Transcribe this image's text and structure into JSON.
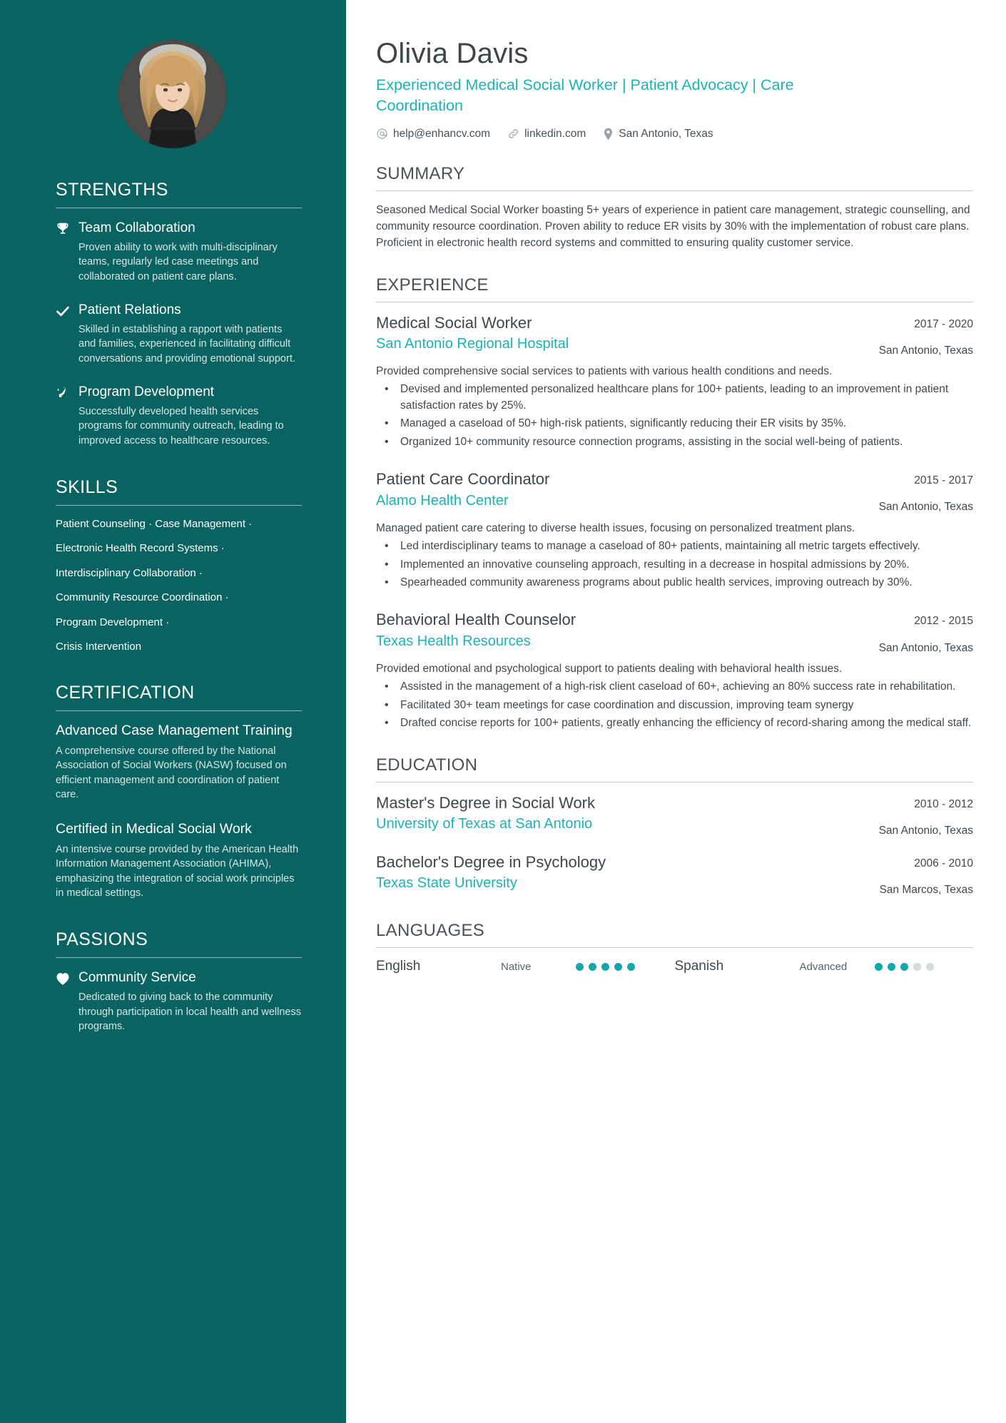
{
  "theme": {
    "sidebar_bg": "#0a6360",
    "accent": "#1ab3b8",
    "text": "#42484d"
  },
  "header": {
    "name": "Olivia Davis",
    "headline": "Experienced Medical Social Worker | Patient Advocacy | Care Coordination",
    "contacts": [
      {
        "icon": "at-icon",
        "text": "help@enhancv.com"
      },
      {
        "icon": "link-icon",
        "text": "linkedin.com"
      },
      {
        "icon": "location-pin-icon",
        "text": "San Antonio, Texas"
      }
    ]
  },
  "sidebar": {
    "strengths": {
      "heading": "STRENGTHS",
      "items": [
        {
          "icon": "trophy-icon",
          "title": "Team Collaboration",
          "description": "Proven ability to work with multi-disciplinary teams, regularly led case meetings and collaborated on patient care plans."
        },
        {
          "icon": "check-icon",
          "title": "Patient Relations",
          "description": "Skilled in establishing a rapport with patients and families, experienced in facilitating difficult conversations and providing emotional support."
        },
        {
          "icon": "rocket-launch-icon",
          "title": "Program Development",
          "description": "Successfully developed health services programs for community outreach, leading to improved access to healthcare resources."
        }
      ]
    },
    "skills": {
      "heading": "SKILLS",
      "lines": [
        "Patient Counseling · Case Management ·",
        "Electronic Health Record Systems ·",
        "Interdisciplinary Collaboration ·",
        "Community Resource Coordination ·",
        "Program Development ·",
        "Crisis Intervention"
      ]
    },
    "certification": {
      "heading": "CERTIFICATION",
      "items": [
        {
          "title": "Advanced Case Management Training",
          "description": "A comprehensive course offered by the National Association of Social Workers (NASW) focused on efficient management and coordination of patient care."
        },
        {
          "title": "Certified in Medical Social Work",
          "description": "An intensive course provided by the American Health Information Management Association (AHIMA), emphasizing the integration of social work principles in medical settings."
        }
      ]
    },
    "passions": {
      "heading": "PASSIONS",
      "items": [
        {
          "icon": "heart-icon",
          "title": "Community Service",
          "description": "Dedicated to giving back to the community through participation in local health and wellness programs."
        }
      ]
    }
  },
  "main": {
    "summary": {
      "heading": "SUMMARY",
      "text": "Seasoned Medical Social Worker boasting 5+ years of experience in patient care management, strategic counselling, and community resource coordination. Proven ability to reduce ER visits by 30% with the implementation of robust care plans. Proficient in electronic health record systems and committed to ensuring quality customer service."
    },
    "experience": {
      "heading": "EXPERIENCE",
      "entries": [
        {
          "role": "Medical Social Worker",
          "org": "San Antonio Regional Hospital",
          "date": "2017 - 2020",
          "location": "San Antonio, Texas",
          "description": "Provided comprehensive social services to patients with various health conditions and needs.",
          "bullets": [
            "Devised and implemented personalized healthcare plans for 100+ patients, leading to an improvement in patient satisfaction rates by 25%.",
            "Managed a caseload of 50+ high-risk patients, significantly reducing their ER visits by 35%.",
            "Organized 10+ community resource connection programs, assisting in the social well-being of patients."
          ]
        },
        {
          "role": "Patient Care Coordinator",
          "org": "Alamo Health Center",
          "date": "2015 - 2017",
          "location": "San Antonio, Texas",
          "description": "Managed patient care catering to diverse health issues, focusing on personalized treatment plans.",
          "bullets": [
            "Led interdisciplinary teams to manage a caseload of 80+ patients, maintaining all metric targets effectively.",
            "Implemented an innovative counseling approach, resulting in a decrease in hospital admissions by 20%.",
            "Spearheaded community awareness programs about public health services, improving outreach by 30%."
          ]
        },
        {
          "role": "Behavioral Health Counselor",
          "org": "Texas Health Resources",
          "date": "2012 - 2015",
          "location": "San Antonio, Texas",
          "description": "Provided emotional and psychological support to patients dealing with behavioral health issues.",
          "bullets": [
            "Assisted in the management of a high-risk client caseload of 60+, achieving an 80% success rate in rehabilitation.",
            "Facilitated 30+ team meetings for case coordination and discussion, improving team synergy",
            "Drafted concise reports for 100+ patients, greatly enhancing the efficiency of record-sharing among the medical staff."
          ]
        }
      ]
    },
    "education": {
      "heading": "EDUCATION",
      "entries": [
        {
          "degree": "Master's Degree in Social Work",
          "school": "University of Texas at San Antonio",
          "date": "2010 - 2012",
          "location": "San Antonio, Texas"
        },
        {
          "degree": "Bachelor's Degree in Psychology",
          "school": "Texas State University",
          "date": "2006 - 2010",
          "location": "San Marcos, Texas"
        }
      ]
    },
    "languages": {
      "heading": "LANGUAGES",
      "items": [
        {
          "name": "English",
          "level": "Native",
          "filled": 5,
          "total": 5
        },
        {
          "name": "Spanish",
          "level": "Advanced",
          "filled": 3,
          "total": 5
        }
      ]
    }
  }
}
